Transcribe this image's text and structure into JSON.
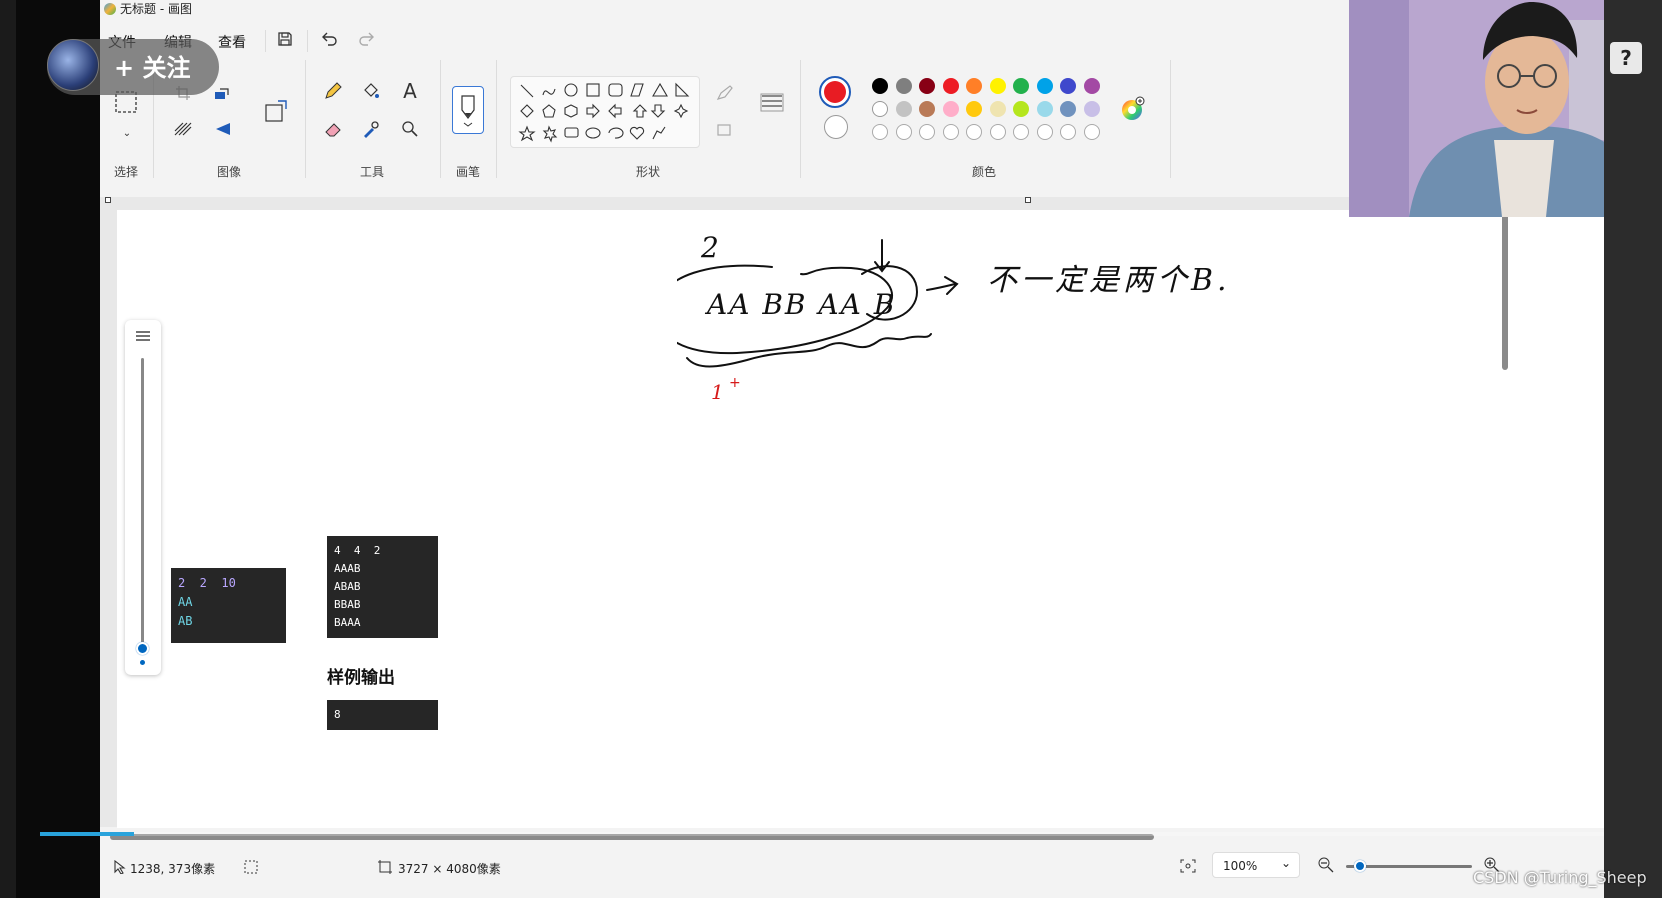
{
  "window": {
    "title": "无标题 - 画图"
  },
  "menu": {
    "file": "文件",
    "edit": "编辑",
    "view": "查看"
  },
  "ribbon": {
    "select_label": "选择",
    "image_label": "图像",
    "tools_label": "工具",
    "brush_label": "画笔",
    "shapes_label": "形状",
    "colors_label": "颜色"
  },
  "colors": {
    "primary": "#e81c23",
    "secondary": "#ffffff",
    "palette_row1": [
      "#000000",
      "#7f7f7f",
      "#880015",
      "#ed1c24",
      "#ff7f27",
      "#fff200",
      "#22b14c",
      "#00a2e8",
      "#3f48cc",
      "#a349a4"
    ],
    "palette_row2": [
      "#ffffff",
      "#c3c3c3",
      "#b97a57",
      "#ffaec9",
      "#ffc90e",
      "#efe4b0",
      "#b5e61d",
      "#99d9ea",
      "#7092be",
      "#c8bfe7"
    ],
    "accent": "#0067c0"
  },
  "canvas": {
    "sample_input_1": [
      "2  2  10",
      "AA",
      "AB"
    ],
    "sample_input_2": [
      "4  4  2",
      "AAAB",
      "ABAB",
      "BBAB",
      "BAAA"
    ],
    "sample_output_heading": "样例输出",
    "sample_output": "8",
    "handwriting": {
      "num_top": "2",
      "strings": "AA BB AA B",
      "note": "不一定是两个B.",
      "num_bottom": "1"
    }
  },
  "statusbar": {
    "cursor_pos": "1238, 373像素",
    "canvas_size": "3727 × 4080像素",
    "zoom": "100%"
  },
  "overlay": {
    "follow_label": "+ 关注",
    "help": "?",
    "watermark": "CSDN @Turing_Sheep",
    "playback_progress": 0.06
  }
}
